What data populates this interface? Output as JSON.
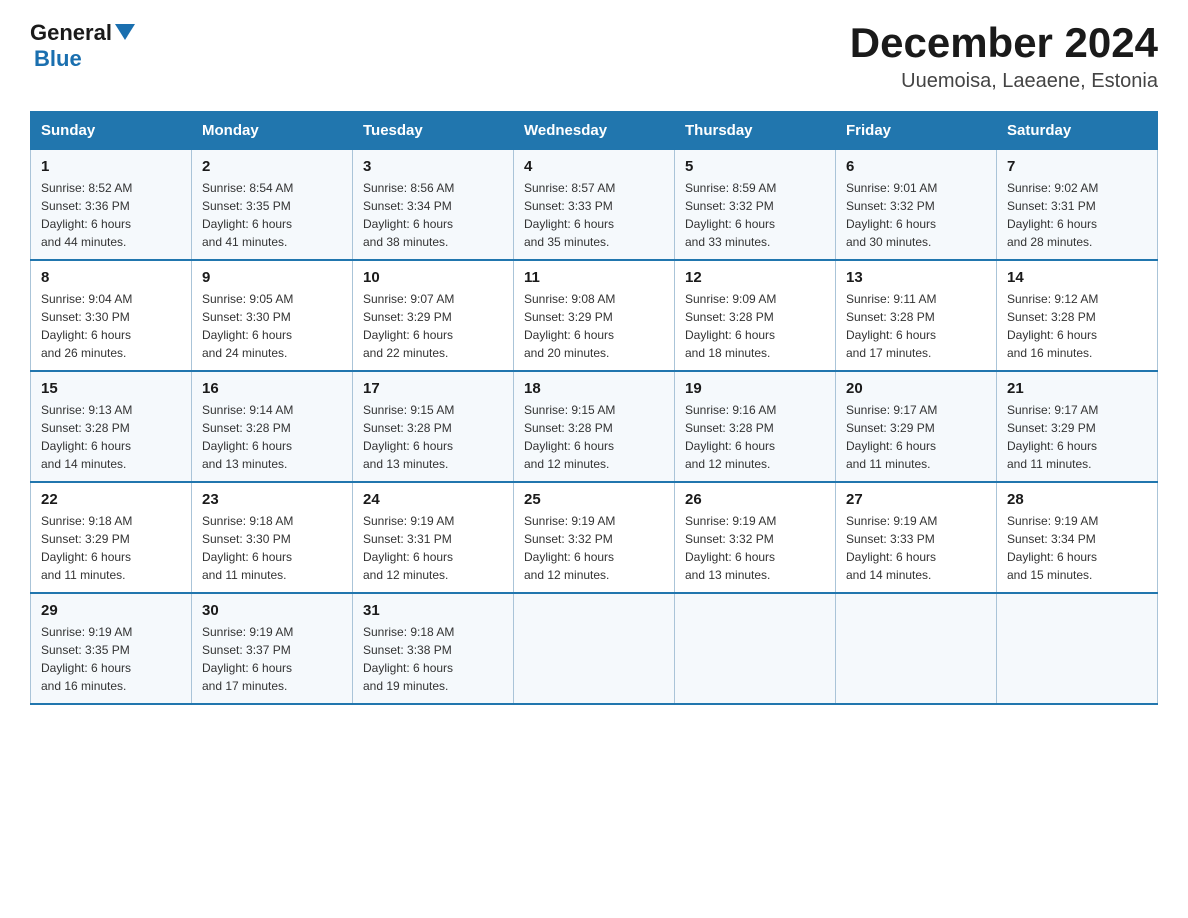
{
  "header": {
    "logo_general": "General",
    "logo_blue": "Blue",
    "title": "December 2024",
    "location": "Uuemoisa, Laeaene, Estonia"
  },
  "days_of_week": [
    "Sunday",
    "Monday",
    "Tuesday",
    "Wednesday",
    "Thursday",
    "Friday",
    "Saturday"
  ],
  "weeks": [
    [
      {
        "day": "1",
        "sunrise": "8:52 AM",
        "sunset": "3:36 PM",
        "daylight": "6 hours and 44 minutes."
      },
      {
        "day": "2",
        "sunrise": "8:54 AM",
        "sunset": "3:35 PM",
        "daylight": "6 hours and 41 minutes."
      },
      {
        "day": "3",
        "sunrise": "8:56 AM",
        "sunset": "3:34 PM",
        "daylight": "6 hours and 38 minutes."
      },
      {
        "day": "4",
        "sunrise": "8:57 AM",
        "sunset": "3:33 PM",
        "daylight": "6 hours and 35 minutes."
      },
      {
        "day": "5",
        "sunrise": "8:59 AM",
        "sunset": "3:32 PM",
        "daylight": "6 hours and 33 minutes."
      },
      {
        "day": "6",
        "sunrise": "9:01 AM",
        "sunset": "3:32 PM",
        "daylight": "6 hours and 30 minutes."
      },
      {
        "day": "7",
        "sunrise": "9:02 AM",
        "sunset": "3:31 PM",
        "daylight": "6 hours and 28 minutes."
      }
    ],
    [
      {
        "day": "8",
        "sunrise": "9:04 AM",
        "sunset": "3:30 PM",
        "daylight": "6 hours and 26 minutes."
      },
      {
        "day": "9",
        "sunrise": "9:05 AM",
        "sunset": "3:30 PM",
        "daylight": "6 hours and 24 minutes."
      },
      {
        "day": "10",
        "sunrise": "9:07 AM",
        "sunset": "3:29 PM",
        "daylight": "6 hours and 22 minutes."
      },
      {
        "day": "11",
        "sunrise": "9:08 AM",
        "sunset": "3:29 PM",
        "daylight": "6 hours and 20 minutes."
      },
      {
        "day": "12",
        "sunrise": "9:09 AM",
        "sunset": "3:28 PM",
        "daylight": "6 hours and 18 minutes."
      },
      {
        "day": "13",
        "sunrise": "9:11 AM",
        "sunset": "3:28 PM",
        "daylight": "6 hours and 17 minutes."
      },
      {
        "day": "14",
        "sunrise": "9:12 AM",
        "sunset": "3:28 PM",
        "daylight": "6 hours and 16 minutes."
      }
    ],
    [
      {
        "day": "15",
        "sunrise": "9:13 AM",
        "sunset": "3:28 PM",
        "daylight": "6 hours and 14 minutes."
      },
      {
        "day": "16",
        "sunrise": "9:14 AM",
        "sunset": "3:28 PM",
        "daylight": "6 hours and 13 minutes."
      },
      {
        "day": "17",
        "sunrise": "9:15 AM",
        "sunset": "3:28 PM",
        "daylight": "6 hours and 13 minutes."
      },
      {
        "day": "18",
        "sunrise": "9:15 AM",
        "sunset": "3:28 PM",
        "daylight": "6 hours and 12 minutes."
      },
      {
        "day": "19",
        "sunrise": "9:16 AM",
        "sunset": "3:28 PM",
        "daylight": "6 hours and 12 minutes."
      },
      {
        "day": "20",
        "sunrise": "9:17 AM",
        "sunset": "3:29 PM",
        "daylight": "6 hours and 11 minutes."
      },
      {
        "day": "21",
        "sunrise": "9:17 AM",
        "sunset": "3:29 PM",
        "daylight": "6 hours and 11 minutes."
      }
    ],
    [
      {
        "day": "22",
        "sunrise": "9:18 AM",
        "sunset": "3:29 PM",
        "daylight": "6 hours and 11 minutes."
      },
      {
        "day": "23",
        "sunrise": "9:18 AM",
        "sunset": "3:30 PM",
        "daylight": "6 hours and 11 minutes."
      },
      {
        "day": "24",
        "sunrise": "9:19 AM",
        "sunset": "3:31 PM",
        "daylight": "6 hours and 12 minutes."
      },
      {
        "day": "25",
        "sunrise": "9:19 AM",
        "sunset": "3:32 PM",
        "daylight": "6 hours and 12 minutes."
      },
      {
        "day": "26",
        "sunrise": "9:19 AM",
        "sunset": "3:32 PM",
        "daylight": "6 hours and 13 minutes."
      },
      {
        "day": "27",
        "sunrise": "9:19 AM",
        "sunset": "3:33 PM",
        "daylight": "6 hours and 14 minutes."
      },
      {
        "day": "28",
        "sunrise": "9:19 AM",
        "sunset": "3:34 PM",
        "daylight": "6 hours and 15 minutes."
      }
    ],
    [
      {
        "day": "29",
        "sunrise": "9:19 AM",
        "sunset": "3:35 PM",
        "daylight": "6 hours and 16 minutes."
      },
      {
        "day": "30",
        "sunrise": "9:19 AM",
        "sunset": "3:37 PM",
        "daylight": "6 hours and 17 minutes."
      },
      {
        "day": "31",
        "sunrise": "9:18 AM",
        "sunset": "3:38 PM",
        "daylight": "6 hours and 19 minutes."
      },
      null,
      null,
      null,
      null
    ]
  ],
  "labels": {
    "sunrise": "Sunrise:",
    "sunset": "Sunset:",
    "daylight": "Daylight:"
  }
}
